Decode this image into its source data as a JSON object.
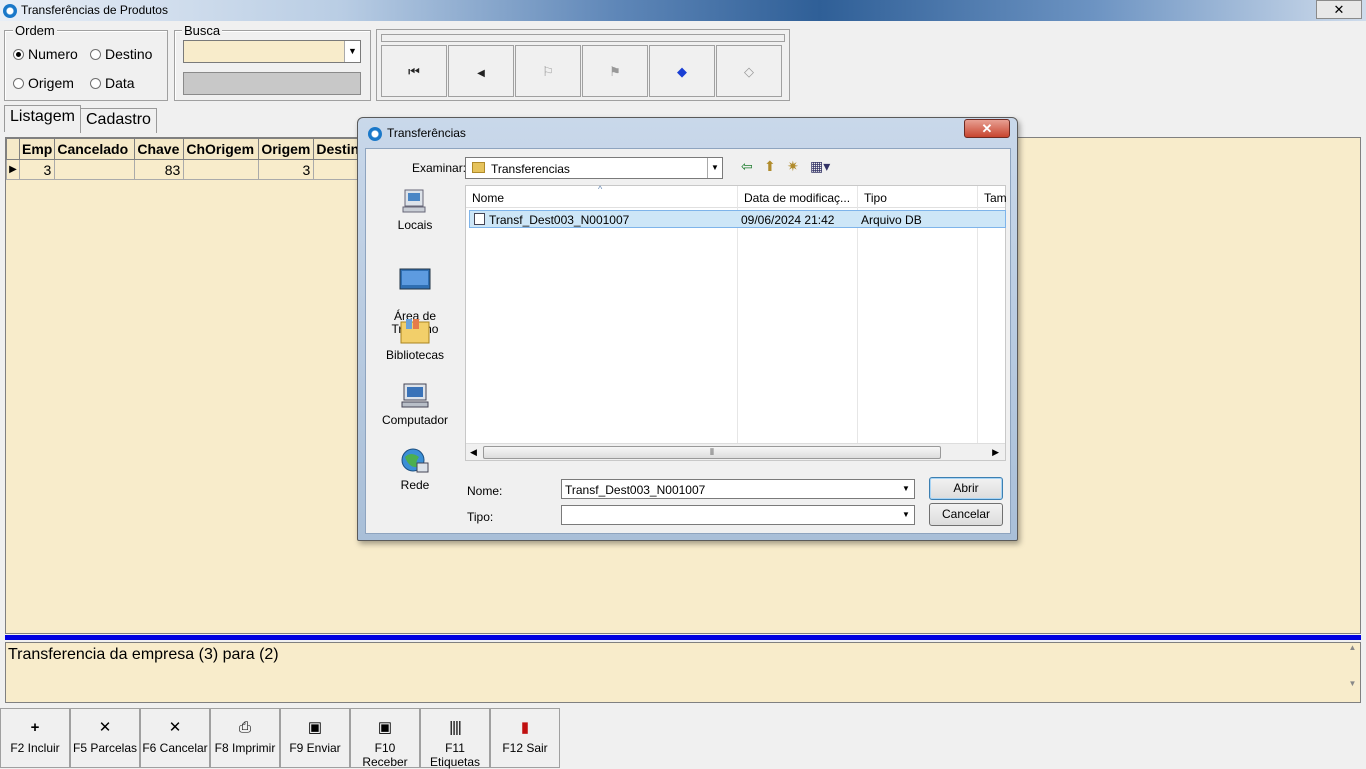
{
  "window": {
    "title": "Transferências de Produtos",
    "close_glyph": "✕"
  },
  "ordem": {
    "label": "Ordem",
    "options": [
      {
        "label": "Numero",
        "selected": true
      },
      {
        "label": "Destino",
        "selected": false
      },
      {
        "label": "Origem",
        "selected": false
      },
      {
        "label": "Data",
        "selected": false
      }
    ]
  },
  "busca": {
    "label": "Busca",
    "value": ""
  },
  "navigator": {
    "buttons": [
      "first-record-icon",
      "prior-record-icon",
      "post-icon",
      "cancel-edit-icon",
      "eraser-blue-icon",
      "eraser-gray-icon"
    ]
  },
  "tabs": {
    "listagem": "Listagem",
    "cadastro": "Cadastro"
  },
  "grid": {
    "columns": [
      "Emp",
      "Cancelado",
      "Chave",
      "ChOrigem",
      "Origem",
      "Destin"
    ],
    "rows": [
      {
        "emp": "3",
        "cancelado": "",
        "chave": "83",
        "chorigem": "",
        "origem": "3",
        "destino": ""
      }
    ]
  },
  "memo": {
    "text": "Transferencia da empresa (3) para (2)"
  },
  "fkeys": [
    {
      "label": "F2 Incluir",
      "icon": "plus-icon"
    },
    {
      "label": "F5 Parcelas",
      "icon": "x-icon"
    },
    {
      "label": "F6 Cancelar",
      "icon": "x-icon"
    },
    {
      "label": "F8 Imprimir",
      "icon": "printer-icon"
    },
    {
      "label": "F9 Enviar",
      "icon": "floppy-icon"
    },
    {
      "label": "F10 Receber",
      "icon": "floppy-icon"
    },
    {
      "label": "F11 Etiquetas",
      "icon": "barcode-icon"
    },
    {
      "label": "F12 Sair",
      "icon": "exit-icon"
    }
  ],
  "dialog": {
    "title": "Transferências",
    "close_glyph": "✕",
    "look_in_label": "Examinar:",
    "look_in_value": "Transferencias",
    "places": [
      "Locais",
      "Área de\nTrabalho",
      "Bibliotecas",
      "Computador",
      "Rede"
    ],
    "columns": {
      "name": "Nome",
      "modified": "Data de modificaç...",
      "type": "Tipo",
      "size": "Tam"
    },
    "file": {
      "name": "Transf_Dest003_N001007",
      "modified": "09/06/2024 21:42",
      "type": "Arquivo DB"
    },
    "name_label": "Nome:",
    "name_value": "Transf_Dest003_N001007",
    "type_label": "Tipo:",
    "type_value": "",
    "open_button": "Abrir",
    "cancel_button": "Cancelar"
  },
  "colors": {
    "grid_bg": "#f8eccb",
    "accent_bar": "#0000e0"
  }
}
